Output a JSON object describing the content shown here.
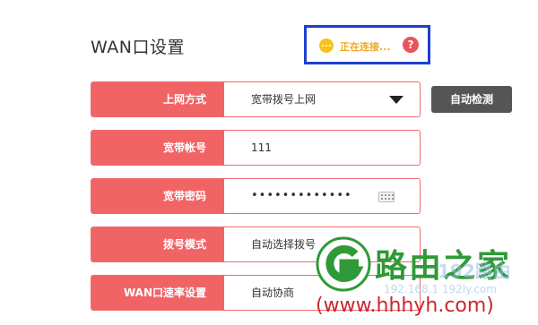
{
  "page": {
    "title": "WAN口设置"
  },
  "status": {
    "text": "正在连接...",
    "help": "?"
  },
  "form": {
    "rows": [
      {
        "label": "上网方式",
        "value": "宽带拨号上网"
      },
      {
        "label": "宽带帐号",
        "value": "111"
      },
      {
        "label": "宽带密码",
        "value": "•••••••••••••"
      },
      {
        "label": "拨号模式",
        "value": "自动选择拨号"
      },
      {
        "label": "WAN口速率设置",
        "value": "自动协商"
      }
    ]
  },
  "buttons": {
    "auto_detect": "自动检测"
  },
  "watermark": {
    "brand": "路由之家",
    "faded": "192路由",
    "faded_url": "192.168.1 192ly.com",
    "url": "(www.hhhyh.com)"
  },
  "colors": {
    "label_bg": "#f16466",
    "status_text": "#f0a91e",
    "highlight_border": "#1f3fcf",
    "brand_green": "#2f9a37"
  }
}
